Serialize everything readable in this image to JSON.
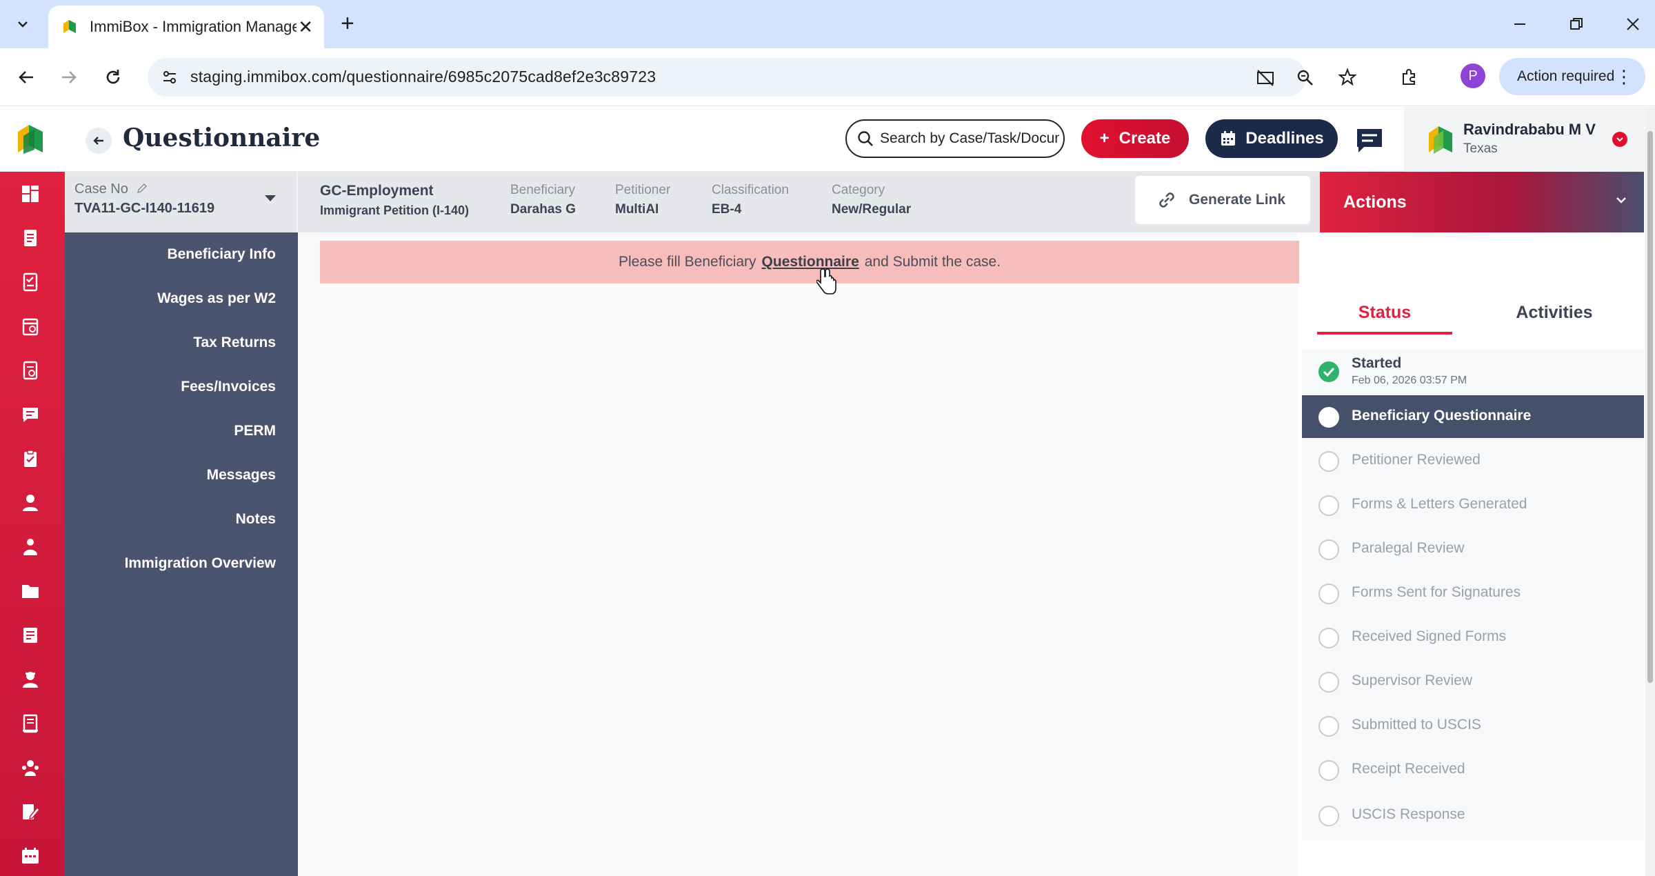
{
  "browser": {
    "tab_title": "ImmiBox - Immigration Manage",
    "url": "staging.immibox.com/questionnaire/6985c2075cad8ef2e3c89723",
    "profile_initial": "P",
    "action_required": "Action required"
  },
  "header": {
    "title": "Questionnaire",
    "search_placeholder": "Search by Case/Task/Document",
    "create_label": "Create",
    "deadlines_label": "Deadlines",
    "user_name": "Ravindrababu M V",
    "user_location": "Texas"
  },
  "case": {
    "case_no_label": "Case No",
    "case_no": "TVA11-GC-I140-11619",
    "type": "GC-Employment",
    "subtype": "Immigrant Petition (I-140)",
    "beneficiary_label": "Beneficiary",
    "beneficiary": "Darahas G",
    "petitioner_label": "Petitioner",
    "petitioner": "MultiAI",
    "classification_label": "Classification",
    "classification": "EB-4",
    "category_label": "Category",
    "category": "New/Regular",
    "generate_link": "Generate Link",
    "actions": "Actions"
  },
  "nav": {
    "items": [
      {
        "label": "Beneficiary Info"
      },
      {
        "label": "Wages as per W2"
      },
      {
        "label": "Tax Returns"
      },
      {
        "label": "Fees/Invoices"
      },
      {
        "label": "PERM"
      },
      {
        "label": "Messages"
      },
      {
        "label": "Notes"
      },
      {
        "label": "Immigration Overview"
      }
    ]
  },
  "alert": {
    "before": "Please fill Beneficiary",
    "link": "Questionnaire",
    "after": "and Submit the case."
  },
  "panel": {
    "tab_status": "Status",
    "tab_activities": "Activities",
    "steps": [
      {
        "label": "Started",
        "sub": "Feb 06, 2026 03:57 PM",
        "state": "done"
      },
      {
        "label": "Beneficiary Questionnaire",
        "state": "active"
      },
      {
        "label": "Petitioner Reviewed",
        "state": "pending"
      },
      {
        "label": "Forms & Letters Generated",
        "state": "pending"
      },
      {
        "label": "Paralegal Review",
        "state": "pending"
      },
      {
        "label": "Forms Sent for Signatures",
        "state": "pending"
      },
      {
        "label": "Received Signed Forms",
        "state": "pending"
      },
      {
        "label": "Supervisor Review",
        "state": "pending"
      },
      {
        "label": "Submitted to USCIS",
        "state": "pending"
      },
      {
        "label": "Receipt Received",
        "state": "pending"
      },
      {
        "label": "USCIS Response",
        "state": "pending"
      }
    ]
  },
  "colors": {
    "brand_red": "#e0213f",
    "nav_slate": "#4a546e",
    "active_step": "#45506a",
    "done_green": "#2fb36b",
    "alert_bg": "#f7bcbc",
    "navy": "#1c2a4a"
  },
  "icons": {
    "rail": [
      "dashboard-icon",
      "document-icon",
      "checklist-icon",
      "calendar-doc-icon",
      "report-icon",
      "chat-icon",
      "clipboard-icon",
      "user-icon",
      "group-icon",
      "folder-icon",
      "notes-icon",
      "agent-icon",
      "ledger-icon",
      "team-icon",
      "edit-doc-icon",
      "schedule-icon"
    ]
  }
}
